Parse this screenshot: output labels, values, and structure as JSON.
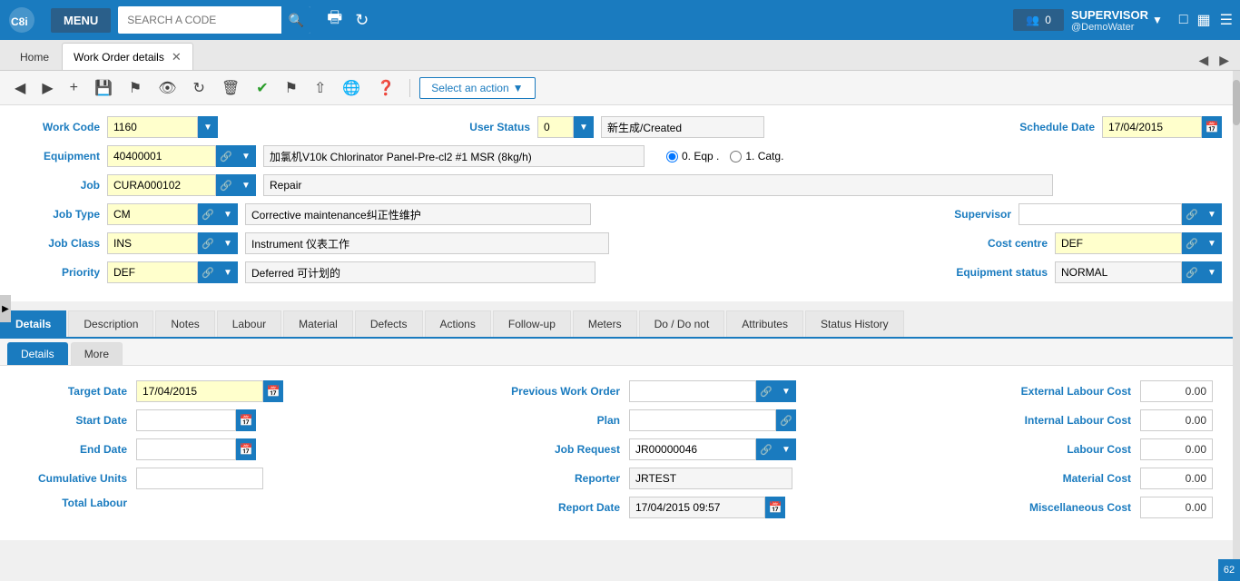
{
  "app": {
    "name": "Coswin 8i",
    "menu_label": "MENU"
  },
  "search": {
    "placeholder": "SEARCH A CODE"
  },
  "user": {
    "role": "SUPERVISOR",
    "account": "@DemoWater",
    "notification_count": "0"
  },
  "tabs": {
    "home_label": "Home",
    "active_tab_label": "Work Order details"
  },
  "toolbar": {
    "action_btn_label": "Select an action"
  },
  "form": {
    "work_code_label": "Work Code",
    "work_code_value": "1160",
    "user_status_label": "User Status",
    "user_status_value": "0",
    "user_status_text": "新生成/Created",
    "schedule_date_label": "Schedule Date",
    "schedule_date_value": "17/04/2015",
    "equipment_label": "Equipment",
    "equipment_value": "40400001",
    "equipment_desc": "加氯机V10k Chlorinator Panel-Pre-cl2 #1 MSR (8kg/h)",
    "eqp_radio": "0. Eqp .",
    "catg_radio": "1. Catg.",
    "job_label": "Job",
    "job_value": "CURA000102",
    "job_desc": "Repair",
    "job_type_label": "Job Type",
    "job_type_value": "CM",
    "job_type_desc": "Corrective maintenance纠正性维护",
    "supervisor_label": "Supervisor",
    "supervisor_value": "",
    "job_class_label": "Job Class",
    "job_class_value": "INS",
    "job_class_desc": "Instrument 仪表工作",
    "cost_centre_label": "Cost centre",
    "cost_centre_value": "DEF",
    "priority_label": "Priority",
    "priority_value": "DEF",
    "priority_desc": "Deferred 可计划的",
    "equipment_status_label": "Equipment status",
    "equipment_status_value": "NORMAL"
  },
  "section_tabs": [
    {
      "label": "Details",
      "active": true
    },
    {
      "label": "Description",
      "active": false
    },
    {
      "label": "Notes",
      "active": false
    },
    {
      "label": "Labour",
      "active": false
    },
    {
      "label": "Material",
      "active": false
    },
    {
      "label": "Defects",
      "active": false
    },
    {
      "label": "Actions",
      "active": false
    },
    {
      "label": "Follow-up",
      "active": false
    },
    {
      "label": "Meters",
      "active": false
    },
    {
      "label": "Do / Do not",
      "active": false
    },
    {
      "label": "Attributes",
      "active": false
    },
    {
      "label": "Status History",
      "active": false
    }
  ],
  "sub_tabs": [
    {
      "label": "Details",
      "active": true
    },
    {
      "label": "More",
      "active": false
    }
  ],
  "detail_form": {
    "target_date_label": "Target Date",
    "target_date_value": "17/04/2015",
    "start_date_label": "Start Date",
    "start_date_value": "",
    "end_date_label": "End Date",
    "end_date_value": "",
    "cumulative_units_label": "Cumulative Units",
    "cumulative_units_value": "",
    "total_labour_label": "Total Labour",
    "prev_work_order_label": "Previous Work Order",
    "prev_work_order_value": "",
    "plan_label": "Plan",
    "plan_value": "",
    "job_request_label": "Job Request",
    "job_request_value": "JR00000046",
    "reporter_label": "Reporter",
    "reporter_value": "JRTEST",
    "report_date_label": "Report Date",
    "report_date_value": "17/04/2015 09:57",
    "ext_labour_cost_label": "External Labour Cost",
    "ext_labour_cost_value": "0.00",
    "int_labour_cost_label": "Internal Labour Cost",
    "int_labour_cost_value": "0.00",
    "labour_cost_label": "Labour Cost",
    "labour_cost_value": "0.00",
    "material_cost_label": "Material Cost",
    "material_cost_value": "0.00",
    "misc_cost_label": "Miscellaneous Cost",
    "misc_cost_value": "0.00"
  }
}
